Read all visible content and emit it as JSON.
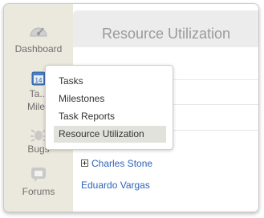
{
  "sidebar": {
    "items": [
      {
        "label": "Dashboard",
        "icon": "dashboard-gauge-icon"
      },
      {
        "label": "Ta... Miles",
        "line1": "Ta...",
        "line2": "Miles",
        "icon": "calendar-icon"
      },
      {
        "label": "Bugs",
        "icon": "bug-icon"
      },
      {
        "label": "Forums",
        "icon": "chat-bubble-icon"
      }
    ]
  },
  "header": {
    "title": "Resource Utilization"
  },
  "rows": [
    {
      "label": "Charles Stone",
      "expandable": true
    },
    {
      "label": "Eduardo Vargas",
      "expandable": false
    }
  ],
  "popup_menu": {
    "items": [
      "Tasks",
      "Milestones",
      "Task Reports",
      "Resource Utilization"
    ],
    "selected_index": 3
  },
  "colors": {
    "sidebar_bg": "#ebe8dd",
    "link": "#2f63b8",
    "selected_bg": "#e2e2dc",
    "title": "#9a9a9a"
  }
}
